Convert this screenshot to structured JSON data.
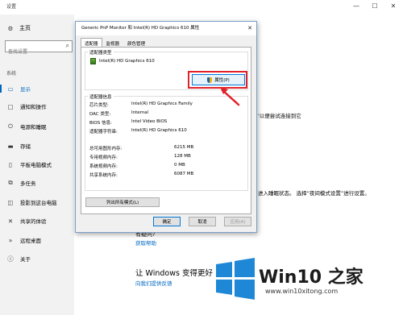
{
  "app": {
    "title": "设置",
    "controls": [
      "—",
      "☐",
      "✕"
    ]
  },
  "sidebar": {
    "home_label": "主页",
    "search_placeholder": "查找设置",
    "section_label": "系统",
    "items": [
      {
        "label": "显示",
        "icon": "display-icon",
        "active": true
      },
      {
        "label": "通知和操作",
        "icon": "notification-icon"
      },
      {
        "label": "电源和睡眠",
        "icon": "power-icon"
      },
      {
        "label": "存储",
        "icon": "storage-icon"
      },
      {
        "label": "平板电脑模式",
        "icon": "tablet-icon"
      },
      {
        "label": "多任务",
        "icon": "multitask-icon"
      },
      {
        "label": "投影到这台电脑",
        "icon": "project-icon"
      },
      {
        "label": "共享的体验",
        "icon": "share-icon"
      },
      {
        "label": "远程桌面",
        "icon": "remote-desktop-icon"
      },
      {
        "label": "关于",
        "icon": "about-icon"
      }
    ]
  },
  "background_content": {
    "line1": "'以便尝试连接到它",
    "line2": "进入睡眠状态。 选择“夜间模式设置”进行设置。",
    "help_heading": "有疑问?",
    "help_link": "获取帮助",
    "improve_heading": "让 Windows 变得更好",
    "feedback_link": "向我们提供反馈"
  },
  "dialog": {
    "title": "Generic PnP Monitor 和 Intel(R) HD Graphics 610 属性",
    "close": "✕",
    "tabs": [
      "适配器",
      "监视器",
      "颜色管理"
    ],
    "adapter_type_label": "适配器类型",
    "adapter_name": "Intel(R) HD Graphics 610",
    "properties_button": "属性(P)",
    "adapter_info_label": "适配器信息",
    "info": [
      {
        "key": "芯片类型:",
        "value": "Intel(R) HD Graphics Family"
      },
      {
        "key": "DAC 类型:",
        "value": "Internal"
      },
      {
        "key": "BIOS 信息:",
        "value": "Intel Video BIOS"
      },
      {
        "key": "适配器字符串:",
        "value": "Intel(R) HD Graphics 610"
      }
    ],
    "memory": [
      {
        "key": "总可用图形内存:",
        "value": "6215 MB"
      },
      {
        "key": "专用视频内存:",
        "value": "128 MB"
      },
      {
        "key": "系统视频内存:",
        "value": "0 MB"
      },
      {
        "key": "共享系统内存:",
        "value": "6087 MB"
      }
    ],
    "list_modes_button": "列出所有模式(L)",
    "ok_button": "确定",
    "cancel_button": "取消",
    "apply_button": "应用(A)"
  },
  "watermark": {
    "brand": "Win10 之家",
    "url": "www.win10xitong.com"
  },
  "colors": {
    "accent": "#0067c0",
    "highlight": "#e0222a",
    "logo_blue": "#1e88d6"
  }
}
